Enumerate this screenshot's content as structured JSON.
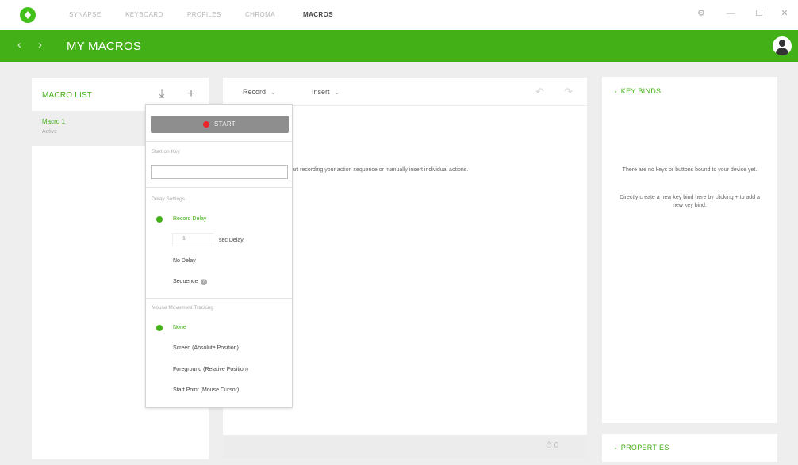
{
  "nav": {
    "items": [
      {
        "label": "SYNAPSE",
        "active": false
      },
      {
        "label": "KEYBOARD",
        "active": false
      },
      {
        "label": "PROFILES",
        "active": false
      },
      {
        "label": "CHROMA",
        "active": false
      },
      {
        "label": "MACROS",
        "active": true
      }
    ],
    "window_buttons": {
      "settings": "⚙",
      "minimize": "—",
      "maximize": "☐",
      "close": "✕"
    }
  },
  "header": {
    "back": "‹",
    "forward": "›",
    "title": "MY MACROS"
  },
  "macro_list": {
    "title": "MACRO LIST",
    "import_icon": "⤓",
    "add_icon": "+",
    "items": [
      {
        "name": "Macro 1",
        "sub": "Active"
      }
    ]
  },
  "editor": {
    "record_label": "Record",
    "insert_label": "Insert",
    "caret": "⌄",
    "undo": "↶",
    "redo": "↷",
    "hint": "art recording your action sequence or manually insert individual actions.",
    "timer": "⏱ 0"
  },
  "record_popup": {
    "start_label": "START",
    "start_delay_label": "Start on Key",
    "delay_settings_label": "Delay Settings",
    "delay_options": [
      "Record Delay",
      "sec Delay",
      "No Delay",
      "Sequence"
    ],
    "delay_value": "1",
    "selected_delay": "Record Delay",
    "mouse_tracking_label": "Mouse Movement Tracking",
    "mouse_options": [
      "None",
      "Screen (Absolute Position)",
      "Foreground (Relative Position)",
      "Start Point (Mouse Cursor)"
    ],
    "selected_mouse": "None",
    "help_glyph": "?"
  },
  "keybinds": {
    "title": "KEY BINDS",
    "text1": "There are no keys or buttons bound to your device yet.",
    "text2": "Directly create a new key bind here by clicking + to add a new key bind."
  },
  "properties": {
    "title": "PROPERTIES"
  },
  "colors": {
    "accent": "#44b017",
    "record_dot": "#e8262a"
  }
}
